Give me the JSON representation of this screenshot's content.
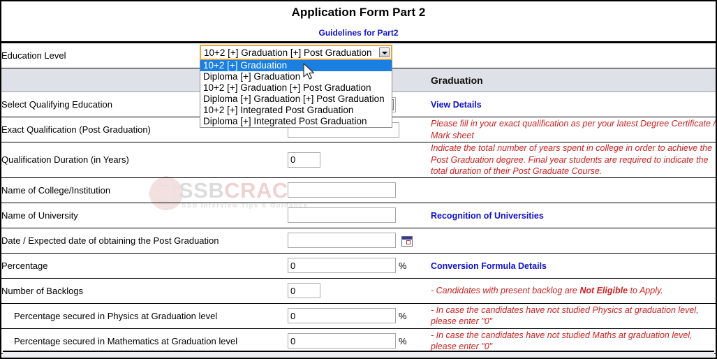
{
  "header": {
    "title": "Application Form Part 2",
    "guidelines_link": "Guidelines for Part2"
  },
  "watermark": {
    "text_a": "SSB",
    "text_b": "CRACK",
    "subtitle": "SSB Interview Tips & Guidance"
  },
  "education_level": {
    "label": "Education Level",
    "selected": "10+2 [+] Graduation [+] Post Graduation",
    "options": [
      "10+2 [+] Graduation",
      "Diploma [+] Graduation",
      "10+2 [+] Graduation [+] Post Graduation",
      "Diploma [+] Graduation [+] Post Graduation",
      "10+2 [+] Integrated Post Graduation",
      "Diploma [+] Integrated Post Graduation"
    ],
    "highlighted_option": "10+2 [+] Graduation"
  },
  "section_band": {
    "text": "Graduation"
  },
  "rows": [
    {
      "label": "Select Qualifying Education",
      "control": "select",
      "value": "",
      "help_kind": "link",
      "help": "View Details"
    },
    {
      "label": "Exact Qualification (Post Graduation)",
      "control": "text",
      "value": "",
      "help_kind": "note",
      "help": "Please fill in your exact qualification as per your latest Degree Certificate / Mark sheet"
    },
    {
      "label": "Qualification Duration (in Years)",
      "control": "text-small",
      "value": "0",
      "help_kind": "note",
      "help": "Indicate the total number of years spent in college in order to achieve the Post Graduation degree. Final year students are required to indicate the total duration of their Post Graduate Course."
    },
    {
      "label": "Name of College/Institution",
      "control": "text",
      "value": "",
      "help_kind": "none",
      "help": ""
    },
    {
      "label": "Name of University",
      "control": "text",
      "value": "",
      "help_kind": "link",
      "help": "Recognition of Universities"
    },
    {
      "label": "Date / Expected date of obtaining the Post Graduation",
      "control": "text-date",
      "value": "",
      "help_kind": "none",
      "help": ""
    },
    {
      "label": "Percentage",
      "control": "text-percent",
      "value": "0",
      "suffix": "%",
      "help_kind": "link",
      "help": "Conversion Formula Details"
    },
    {
      "label": "Number of Backlogs",
      "control": "text-small",
      "value": "0",
      "help_kind": "note-rich",
      "help_pre": "- Candidates with present backlog are ",
      "help_bold": "Not Eligible",
      "help_post": " to Apply."
    },
    {
      "label": "Percentage secured in Physics at Graduation level",
      "control": "text-percent",
      "value": "0",
      "suffix": "%",
      "help_kind": "note",
      "help": "- In case the candidates have not studied Physics at graduation level, please enter \"0\""
    },
    {
      "label": "Percentage secured in Mathematics at Graduation level",
      "control": "text-percent",
      "value": "0",
      "suffix": "%",
      "help_kind": "note",
      "help": "- In case the candidates have not studied Maths at graduation level, please enter \"0\""
    }
  ],
  "colors": {
    "link_blue": "#1111CC",
    "note_red": "#CC2222",
    "band_grey": "#DFE1E8",
    "highlight_blue": "#1A7FE0",
    "focus_orange": "#E8A33D"
  }
}
